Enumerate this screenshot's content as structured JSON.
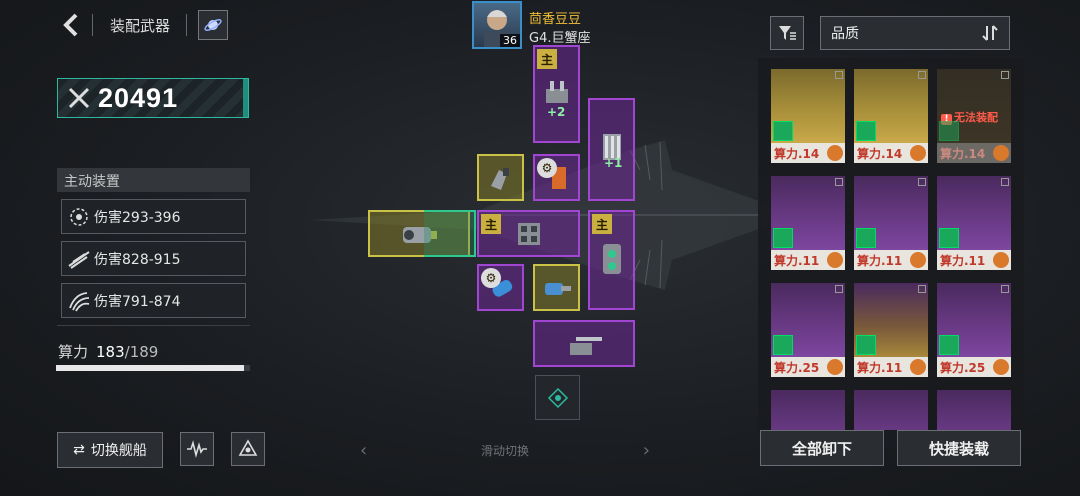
{
  "header": {
    "title": "装配武器",
    "back_icon": "chevron-left-icon",
    "planet_icon": "planet-icon"
  },
  "power": {
    "value": "20491",
    "icon": "crossed-swords-icon"
  },
  "active_equipment": {
    "title": "主动装置",
    "skills": [
      {
        "icon": "spiral-icon",
        "label": "伤害293-396"
      },
      {
        "icon": "slash-icon",
        "label": "伤害828-915"
      },
      {
        "icon": "claw-icon",
        "label": "伤害791-874"
      }
    ]
  },
  "capacity": {
    "label": "算力",
    "used": "183",
    "sep_total": "/189",
    "fraction": 0.968
  },
  "bottom_left": {
    "switch_ship": "切换舰船",
    "switch_icon": "swap-arrows-icon",
    "waveform_icon": "waveform-icon",
    "tri_icon": "triangle-nodes-icon"
  },
  "commander": {
    "name": "茴香豆豆",
    "class": "G4.巨蟹座",
    "level": "36"
  },
  "slots": {
    "main_tag": "主",
    "plus_2": "+2",
    "plus_1": "+1"
  },
  "swipe": {
    "label": "滑动切换",
    "left_arrow": "‹",
    "right_arrow": "›"
  },
  "panel": {
    "filter_icon": "filter-icon",
    "sort_label": "品质",
    "sort_icon": "sort-icon",
    "cards": [
      {
        "rarity": "gold",
        "cost": "算力.14"
      },
      {
        "rarity": "gold",
        "cost": "算力.14"
      },
      {
        "rarity": "dark",
        "cost": "算力.14",
        "unavailable": "无法装配"
      },
      {
        "rarity": "purple",
        "cost": "算力.11"
      },
      {
        "rarity": "purple",
        "cost": "算力.11"
      },
      {
        "rarity": "purple",
        "cost": "算力.11"
      },
      {
        "rarity": "purple",
        "cost": "算力.25"
      },
      {
        "rarity": "purple",
        "cost": "算力.11"
      },
      {
        "rarity": "purple",
        "cost": "算力.25"
      }
    ]
  },
  "actions": {
    "unload_all": "全部卸下",
    "quick_equip": "快捷装载"
  },
  "colors": {
    "accent_teal": "#2fb8a0",
    "purple": "#a146d2",
    "gold": "#c9c247",
    "cost_red": "#c0392b"
  }
}
